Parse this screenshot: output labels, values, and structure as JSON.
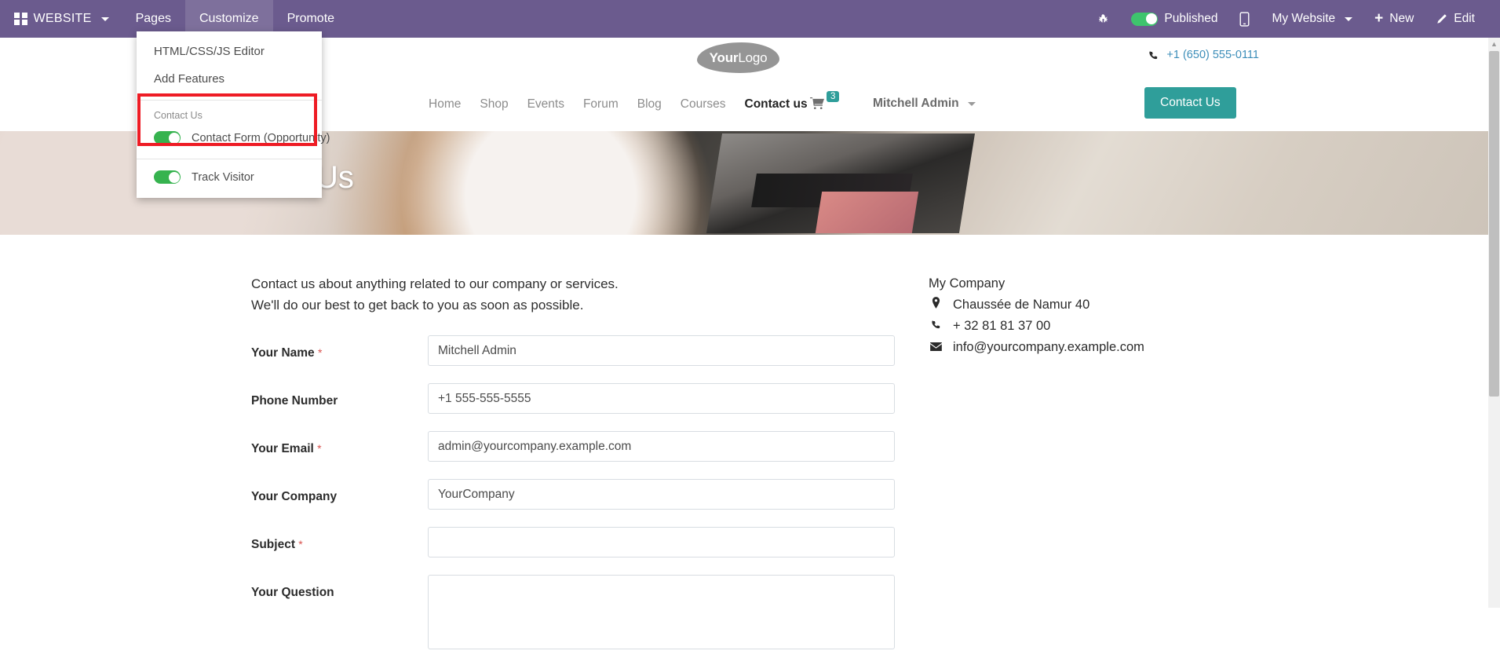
{
  "odoo_bar": {
    "apps_label": "WEBSITE",
    "apps_icon": "grid-apps-icon",
    "menus": [
      {
        "label": "Pages",
        "active": false
      },
      {
        "label": "Customize",
        "active": true
      },
      {
        "label": "Promote",
        "active": false
      }
    ],
    "right": {
      "debug_icon": "bug-icon",
      "published_label": "Published",
      "published_state": "on",
      "mobile_preview_icon": "mobile-icon",
      "website_selector": "My Website",
      "new_label": "New",
      "new_icon": "plus-icon",
      "edit_label": "Edit",
      "edit_icon": "pencil-icon"
    },
    "bar_color": "#6b5b8e"
  },
  "customize_dropdown": {
    "items": [
      {
        "label": "HTML/CSS/JS Editor"
      },
      {
        "label": "Add Features"
      }
    ],
    "group_label": "Contact Us",
    "toggles": [
      {
        "label": "Contact Form (Opportunity)",
        "state": "on",
        "highlighted": true
      },
      {
        "label": "Track Visitor",
        "state": "on",
        "highlighted": false
      }
    ],
    "highlight_color": "#ee1c25",
    "toggle_on_color": "#36b34f"
  },
  "site_header": {
    "logo_text_bold": "Your",
    "logo_text_light": "Logo",
    "phone": "+1 (650) 555-0111",
    "phone_icon": "phone-icon",
    "nav": [
      {
        "label": "Home",
        "active": false
      },
      {
        "label": "Shop",
        "active": false
      },
      {
        "label": "Events",
        "active": false
      },
      {
        "label": "Forum",
        "active": false
      },
      {
        "label": "Blog",
        "active": false
      },
      {
        "label": "Courses",
        "active": false
      },
      {
        "label": "Contact us",
        "active": true
      }
    ],
    "cart": {
      "icon": "shopping-cart-icon",
      "count": "3"
    },
    "user": "Mitchell Admin",
    "cta_label": "Contact Us",
    "cta_color": "#2f9e9a"
  },
  "hero": {
    "title": "Contact Us",
    "background": "desk-flatlay-photo"
  },
  "main": {
    "intro_line1": "Contact us about anything related to our company or services.",
    "intro_line2": "We'll do our best to get back to you as soon as possible.",
    "form": {
      "fields": [
        {
          "label": "Your Name",
          "required": true,
          "value": "Mitchell Admin",
          "type": "text"
        },
        {
          "label": "Phone Number",
          "required": false,
          "value": "+1 555-555-5555",
          "type": "text"
        },
        {
          "label": "Your Email",
          "required": true,
          "value": "admin@yourcompany.example.com",
          "type": "text"
        },
        {
          "label": "Your Company",
          "required": false,
          "value": "YourCompany",
          "type": "text"
        },
        {
          "label": "Subject",
          "required": true,
          "value": "",
          "type": "text"
        },
        {
          "label": "Your Question",
          "required": false,
          "value": "",
          "type": "textarea"
        }
      ],
      "required_marker": "*"
    },
    "company": {
      "name": "My Company",
      "address": "Chaussée de Namur 40",
      "phone": "+ 32 81 81 37 00",
      "email": "info@yourcompany.example.com",
      "address_icon": "map-pin-icon",
      "phone_icon": "phone-icon",
      "email_icon": "envelope-icon"
    }
  },
  "scrollbar": {
    "present": true,
    "up_arrow_icon": "chevron-up-icon"
  }
}
